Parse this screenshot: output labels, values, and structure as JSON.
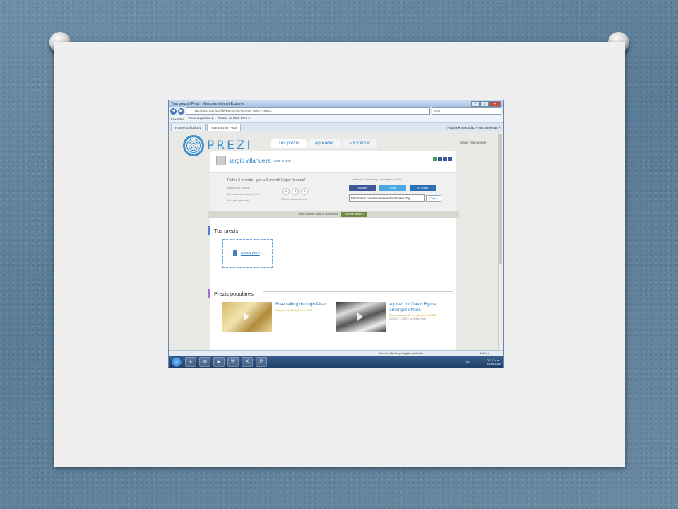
{
  "browser": {
    "window_title": "Your prezis | Prezi - Windows Internet Explorer",
    "url": "http://prezi.com/profile/welcome/?license_type=PUBLIC",
    "search_placeholder": "Bing",
    "favorites_label": "Favoritos",
    "fav_items": [
      "Sitios sugeridos ▾",
      "Galería de Web Slice ▾"
    ],
    "tabs": [
      "Home | Schoology",
      "Your prezis | Prezi"
    ],
    "commands": "Página ▾  Seguridad ▾  Herramientas ▾"
  },
  "prezi": {
    "logo_text": "PREZI",
    "nav_tabs": [
      "Tus prezis",
      "Aprender",
      "⌕ Explorar"
    ],
    "user_menu": "sergio villanueva ▾",
    "profile_name": "sergio villanueva",
    "profile_link": "Crear tu perfil",
    "refer": {
      "heading": "Refer 3 friends - get a 3 month Enjoy license!",
      "steps": [
        "Invite your friends",
        "3 friends start using Prezi",
        "You get upgraded"
      ],
      "circles": [
        "0",
        "0",
        "0"
      ],
      "count_text": "0/3 referrals completed",
      "invite_text": "Invite your friends by sharing these links",
      "share_facebook": "f  Share",
      "share_twitter": "Tweet",
      "share_linkedin": "in  Share",
      "referral_link": "http://prezi.com/recommend/xv8oowcu3aj",
      "copy_label": "Copiar"
    },
    "feature_banner": "New feature: Fade-in Animations",
    "feature_button": "See the details ›",
    "your_prezis_heading": "Tus prezis",
    "new_prezi_label": "Nueva prezi",
    "popular_heading": "Prezis populares",
    "popular": [
      {
        "title": "Free falling through Prezi",
        "meta": "Wiang Lee el 11 de junio de 2012"
      },
      {
        "title": "A prezi for David Byrne amongst others",
        "meta": "Zero Insanatu el 11 de noviembre de 2010",
        "meta2": "1 2 3 4 5 6 7 8 9 ◊ by Sebco Tone"
      }
    ]
  },
  "status": {
    "zone": "Internet | Modo protegido: activado",
    "zoom": "100% ▾"
  },
  "taskbar": {
    "lang": "ES",
    "time": "07:10 a.m.",
    "date": "15/10/2012",
    "apps": [
      "e",
      "▤",
      "▶",
      "W",
      "X",
      "P"
    ]
  },
  "colors": {
    "slide_bg": "#efefef",
    "backdrop": "#5a7c97",
    "prezi_blue": "#3a8fd0"
  }
}
